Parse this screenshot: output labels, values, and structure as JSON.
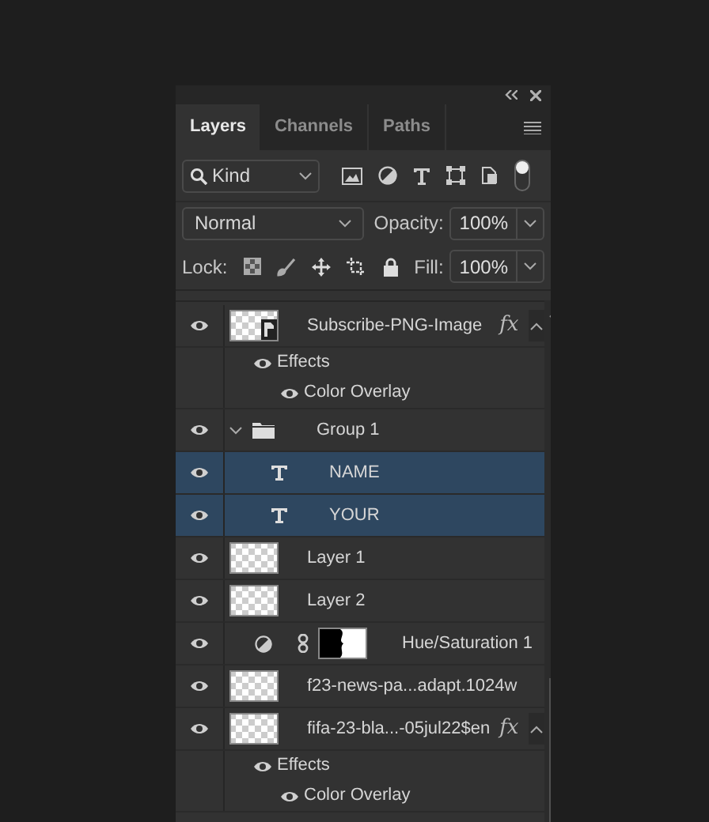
{
  "tabs": [
    {
      "label": "Layers",
      "selected": true
    },
    {
      "label": "Channels",
      "selected": false
    },
    {
      "label": "Paths",
      "selected": false
    }
  ],
  "filter": {
    "value": "Kind"
  },
  "blend_mode": "Normal",
  "opacity": {
    "label": "Opacity:",
    "value": "100%"
  },
  "lock": {
    "label": "Lock:"
  },
  "fill": {
    "label": "Fill:",
    "value": "100%"
  },
  "layers": [
    {
      "kind": "smart_object",
      "name": "Subscribe-PNG-Image",
      "visible": true,
      "selected": false,
      "fx": "fx",
      "effects_label": "Effects",
      "effects_visible": true,
      "effects": [
        {
          "name": "Color Overlay",
          "visible": true
        }
      ]
    },
    {
      "kind": "group",
      "name": "Group 1",
      "visible": true,
      "selected": false,
      "expanded": true,
      "children": [
        {
          "kind": "text",
          "name": "NAME",
          "visible": true,
          "selected": true
        },
        {
          "kind": "text",
          "name": "YOUR",
          "visible": true,
          "selected": true
        }
      ]
    },
    {
      "kind": "pixel",
      "name": "Layer 1",
      "visible": true,
      "selected": false
    },
    {
      "kind": "pixel",
      "name": "Layer 2",
      "visible": true,
      "selected": false
    },
    {
      "kind": "adjustment",
      "name": "Hue/Saturation 1",
      "visible": true,
      "selected": false
    },
    {
      "kind": "pixel",
      "name": "f23-news-pa...adapt.1024w",
      "visible": true,
      "selected": false
    },
    {
      "kind": "pixel",
      "name": "fifa-23-bla...-05jul22$en",
      "visible": true,
      "selected": false,
      "fx": "fx",
      "effects_label": "Effects",
      "effects_visible": true,
      "effects": [
        {
          "name": "Color Overlay",
          "visible": true
        }
      ]
    }
  ]
}
